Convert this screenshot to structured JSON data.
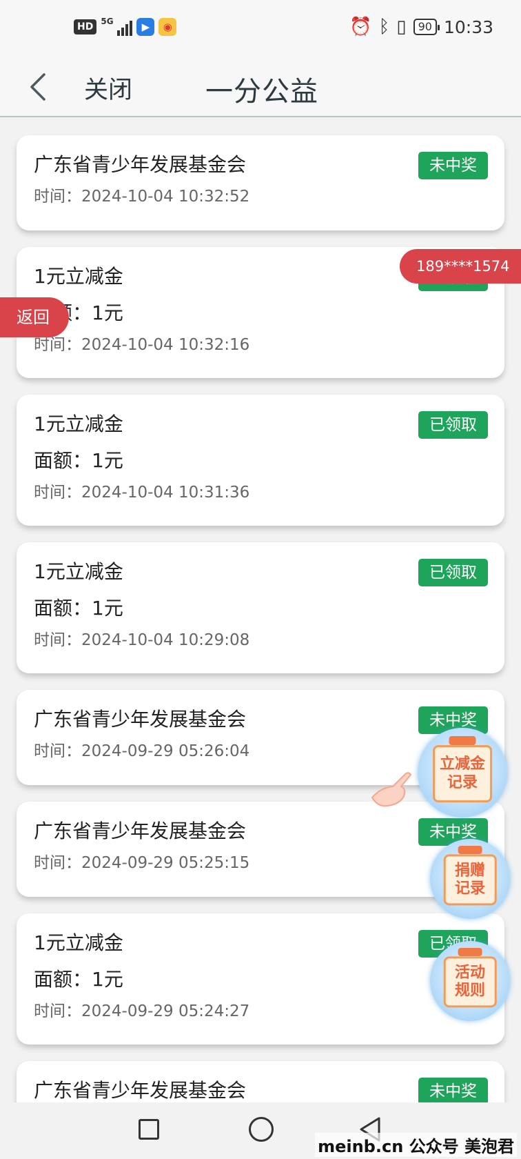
{
  "status_bar": {
    "hd": "HD",
    "network": "5G",
    "battery": "90",
    "time": "10:33",
    "app_icons": [
      "blue-app-icon",
      "weibo-icon"
    ]
  },
  "nav": {
    "close_label": "关闭",
    "title": "一分公益"
  },
  "records": [
    {
      "title": "广东省青少年发展基金会",
      "amount": "",
      "time": "时间：2024-10-04 10:32:52",
      "status": "未中奖"
    },
    {
      "title": "1元立减金",
      "amount": "面额：1元",
      "time": "时间：2024-10-04 10:32:16",
      "status": "已领取"
    },
    {
      "title": "1元立减金",
      "amount": "面额：1元",
      "time": "时间：2024-10-04 10:31:36",
      "status": "已领取"
    },
    {
      "title": "1元立减金",
      "amount": "面额：1元",
      "time": "时间：2024-10-04 10:29:08",
      "status": "已领取"
    },
    {
      "title": "广东省青少年发展基金会",
      "amount": "",
      "time": "时间：2024-09-29 05:26:04",
      "status": "未中奖"
    },
    {
      "title": "广东省青少年发展基金会",
      "amount": "",
      "time": "时间：2024-09-29 05:25:15",
      "status": "未中奖"
    },
    {
      "title": "1元立减金",
      "amount": "面额：1元",
      "time": "时间：2024-09-29 05:24:27",
      "status": "已领取"
    },
    {
      "title": "广东省青少年发展基金会",
      "amount": "",
      "time": "",
      "status": "未中奖"
    }
  ],
  "overlays": {
    "phone": "189****1574",
    "return": "返回"
  },
  "float_buttons": {
    "discount_records_l1": "立减金",
    "discount_records_l2": "记录",
    "donation_records_l1": "捐赠",
    "donation_records_l2": "记录",
    "activity_rules_l1": "活动",
    "activity_rules_l2": "规则"
  },
  "watermark": "meinb.cn  公众号 美泡君",
  "colors": {
    "badge_green": "#1fa45b",
    "tag_red": "#d9444a"
  }
}
